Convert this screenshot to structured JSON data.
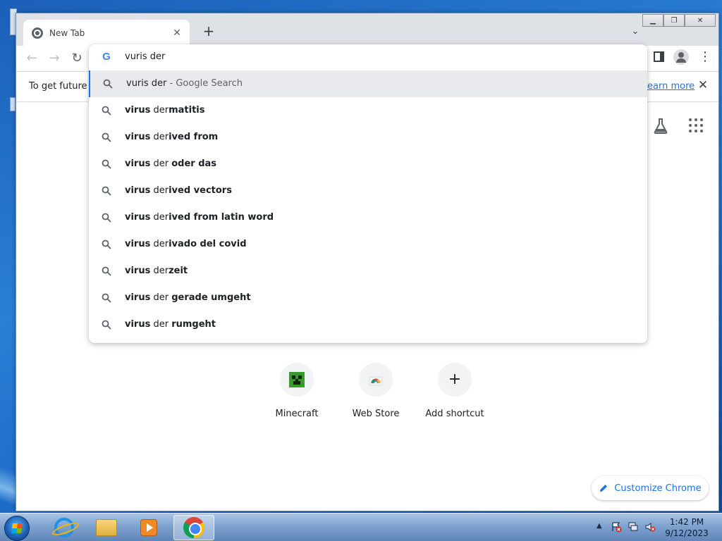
{
  "browser": {
    "tab_title": "New Tab",
    "infobar_text": "To get future G",
    "infobar_link": "Learn more"
  },
  "omnibox": {
    "input_value": "vuris der",
    "first_suggestion": {
      "query": "vuris der",
      "suffix": "- Google Search"
    },
    "suggestions": [
      {
        "plain": "",
        "bold": "virus",
        "rest_plain": " der",
        "rest_bold": "matitis"
      },
      {
        "plain": "",
        "bold": "virus",
        "rest_plain": " der",
        "rest_bold": "ived from"
      },
      {
        "plain": "",
        "bold": "virus",
        "rest_plain": " der ",
        "rest_bold": "oder das"
      },
      {
        "plain": "",
        "bold": "virus",
        "rest_plain": " der",
        "rest_bold": "ived vectors"
      },
      {
        "plain": "",
        "bold": "virus",
        "rest_plain": " der",
        "rest_bold": "ived from latin word"
      },
      {
        "plain": "",
        "bold": "virus",
        "rest_plain": " der",
        "rest_bold": "ivado del covid"
      },
      {
        "plain": "",
        "bold": "virus",
        "rest_plain": " der",
        "rest_bold": "zeit"
      },
      {
        "plain": "",
        "bold": "virus",
        "rest_plain": " der ",
        "rest_bold": "gerade umgeht"
      },
      {
        "plain": "",
        "bold": "virus",
        "rest_plain": " der ",
        "rest_bold": "rumgeht"
      }
    ]
  },
  "shortcuts": [
    {
      "label": "Minecraft",
      "icon": "minecraft-icon"
    },
    {
      "label": "Web Store",
      "icon": "web-store-icon"
    },
    {
      "label": "Add shortcut",
      "icon": "plus-icon"
    }
  ],
  "customize": {
    "label": "Customize Chrome"
  },
  "taskbar": {
    "time": "1:42 PM",
    "date": "9/12/2023"
  },
  "colors": {
    "accent": "#1a73e8",
    "selected_bg": "#e8eaed"
  }
}
